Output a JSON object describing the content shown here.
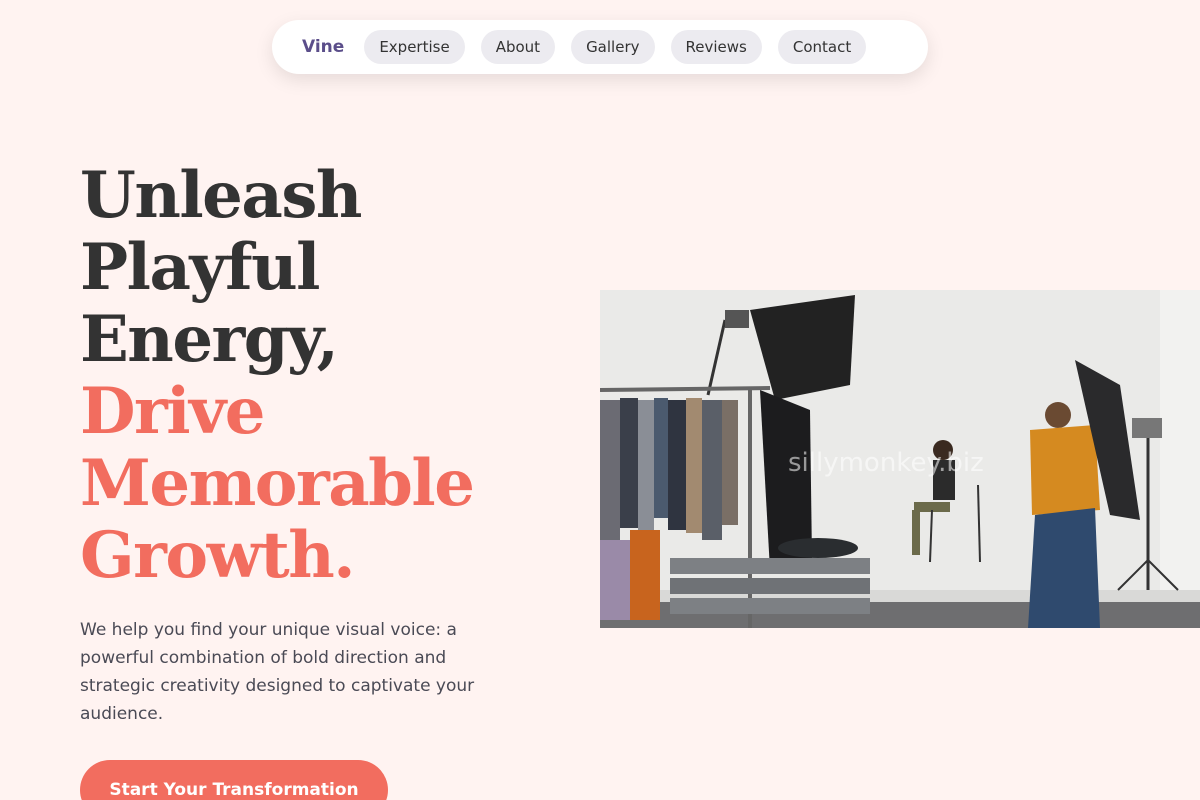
{
  "nav": {
    "brand": "Vine",
    "items": [
      {
        "label": "Expertise"
      },
      {
        "label": "About"
      },
      {
        "label": "Gallery"
      },
      {
        "label": "Reviews"
      },
      {
        "label": "Contact"
      }
    ]
  },
  "hero": {
    "headline_dark": [
      "Unleash",
      "Playful",
      "Energy,"
    ],
    "headline_accent": [
      "Drive",
      "Memorable",
      "Growth."
    ],
    "lead": "We help you find your unique visual voice: a powerful combination of bold direction and strategic creativity designed to captivate your audience.",
    "cta_label": "Start Your Transformation"
  },
  "photo": {
    "watermark": "sillymonkey.biz"
  },
  "colors": {
    "background": "#fff3f1",
    "accent": "#f26d5f",
    "brand": "#5b4e8a",
    "text": "#333333"
  }
}
